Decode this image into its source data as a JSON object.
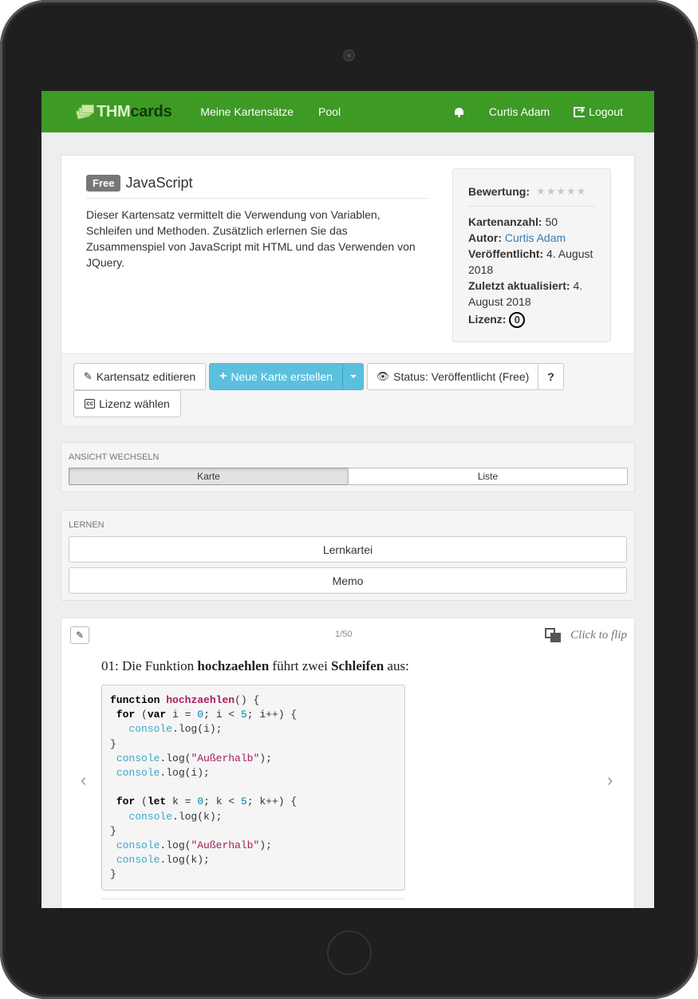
{
  "navbar": {
    "brand_thm": "THM",
    "brand_cards": "cards",
    "links": [
      "Meine Kartensätze",
      "Pool"
    ],
    "user": "Curtis Adam",
    "logout": "Logout",
    "color": "#3d9a25"
  },
  "cardset": {
    "badge": "Free",
    "title": "JavaScript",
    "description": "Dieser Kartensatz vermittelt die Verwendung von Variablen, Schleifen und Methoden. Zusätzlich erlernen Sie das Zusammenspiel von JavaScript mit HTML und das Verwenden von JQuery.",
    "info": {
      "rating_label": "Bewertung:",
      "rating_stars": "★★★★★",
      "rating_value": 0,
      "count_label": "Kartenanzahl:",
      "count": "50",
      "author_label": "Autor:",
      "author": "Curtis Adam",
      "published_label": "Veröffentlicht:",
      "published": "4. August 2018",
      "updated_label": "Zuletzt aktualisiert:",
      "updated": "4. August 2018",
      "license_label": "Lizenz:",
      "license_icon": "0"
    },
    "actions": {
      "edit": "Kartensatz editieren",
      "new_card": "Neue Karte erstellen",
      "status": "Status: Veröffentlicht (Free)",
      "help": "?",
      "license": "Lizenz wählen"
    }
  },
  "view": {
    "label": "Ansicht wechseln",
    "options": [
      "Karte",
      "Liste"
    ],
    "selected": "Karte"
  },
  "learn": {
    "label": "Lernen",
    "buttons": [
      "Lernkartei",
      "Memo"
    ]
  },
  "card": {
    "counter": "1/50",
    "flip": "Click to flip",
    "question_prefix": "01: Die Funktion ",
    "question_fn": "hochzaehlen",
    "question_mid": " führt zwei ",
    "question_loop": "Schleifen",
    "question_suffix": " aus:",
    "code": {
      "l1_kw": "function",
      "l1_fn": "hochzaehlen",
      "l1_rest": "() {",
      "for1": "for",
      "var": "var",
      "let": "let",
      "i": "i",
      "k": "k",
      "zero": "0",
      "five": "5",
      "console": "console",
      "log_i": ".log(i);",
      "log_k": ".log(k);",
      "log_str_a": ".log(",
      "str": "\"Außerhalb\"",
      "log_str_b": ");"
    }
  }
}
